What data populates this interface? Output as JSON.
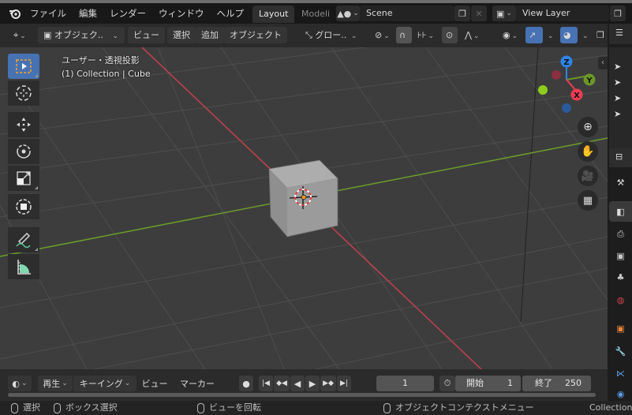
{
  "topbar": {
    "logo_icon": "blender-logo-icon",
    "menus": [
      "ファイル",
      "編集",
      "レンダー",
      "ウィンドウ",
      "ヘルプ"
    ],
    "workspace_tabs": [
      {
        "label": "Layout",
        "active": true
      },
      {
        "label": "Modelir",
        "active": false
      }
    ],
    "scene": {
      "icon": "scene-icon",
      "value": "Scene"
    },
    "view_layer": {
      "icon": "view-layer-icon",
      "value": "View Layer"
    }
  },
  "header": {
    "mode_label": "オブジェク..",
    "menus": [
      "ビュー",
      "選択",
      "追加",
      "オブジェクト"
    ],
    "transform_orientation": "グロー..",
    "icons": [
      "editor-type-icon",
      "object-mode-icon",
      "transform-orientation-icon",
      "pivot-icon",
      "snap-icon",
      "snap-increment-icon",
      "proportional-edit-icon",
      "falloff-icon",
      "visibility-icon",
      "gizmo-icon",
      "overlay-icon"
    ]
  },
  "viewport": {
    "view_name": "ユーザー・透視投影",
    "collection_info": "(1) Collection | Cube",
    "axes": {
      "x": "X",
      "y": "Y",
      "z": "Z"
    },
    "colors": {
      "x_axis": "#c4404f",
      "y_axis": "#6d9d2a",
      "x_gizmo": "#f13c54",
      "y_gizmo": "#6b9728",
      "z_gizmo": "#2f84e8",
      "active_tool": "#4772b3"
    }
  },
  "tools": [
    {
      "name": "select-box",
      "active": true
    },
    {
      "name": "cursor",
      "active": false
    },
    {
      "name": "move",
      "active": false
    },
    {
      "name": "rotate",
      "active": false
    },
    {
      "name": "scale",
      "active": false
    },
    {
      "name": "transform",
      "active": false
    },
    {
      "name": "annotate",
      "active": false
    },
    {
      "name": "measure",
      "active": false
    }
  ],
  "nav_buttons": [
    "zoom-icon",
    "pan-hand-icon",
    "camera-icon",
    "grid-ortho-icon"
  ],
  "properties_tabs": [
    "tool-icon",
    "render-icon",
    "output-icon",
    "view-layer-icon",
    "scene-icon",
    "world-icon",
    "object-icon",
    "modifier-icon",
    "particles-icon",
    "physics-icon"
  ],
  "timeline": {
    "menus": [
      "再生",
      "キーイング",
      "ビュー",
      "マーカー"
    ],
    "current_frame": "1",
    "start_label": "開始",
    "start_value": "1",
    "end_label": "終了",
    "end_value": "250"
  },
  "statusbar": {
    "select": "選択",
    "box_select": "ボックス選択",
    "rotate_view": "ビューを回転",
    "context_menu": "オブジェクトコンテクストメニュー",
    "collection": "Collection"
  }
}
